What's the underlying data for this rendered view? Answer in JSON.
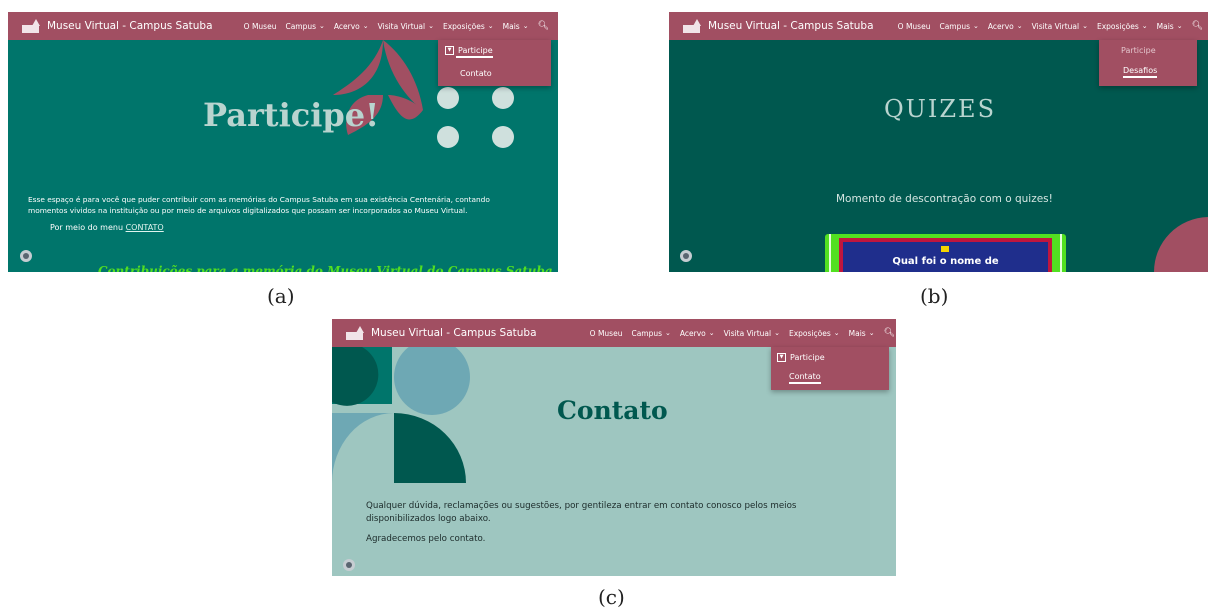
{
  "nav": {
    "site_title": "Museu Virtual - Campus Satuba",
    "items": [
      "O Museu",
      "Campus",
      "Acervo",
      "Visita Virtual",
      "Exposições",
      "Mais"
    ]
  },
  "panel_a": {
    "dropdown": [
      "Participe",
      "Contato"
    ],
    "heading": "Participe!",
    "paragraph": "Esse espaço é para você que puder contribuir com as memórias do Campus Satuba em sua existência Centenária, contando momentos vividos na instituição ou por meio de arquivos digitalizados que possam ser incorporados ao Museu Virtual.",
    "contact_prefix": "Por meio do menu",
    "contact_link": "CONTATO",
    "cut_heading": "Contribuições para a memória do Museu Virtual do Campus Satuba",
    "caption": "(a)"
  },
  "panel_b": {
    "dropdown": [
      "Participe",
      "Desafios"
    ],
    "heading": "QUIZES",
    "subtitle": "Momento de descontração com o quizes!",
    "quiz_text": "Qual foi o nome de",
    "caption": "(b)"
  },
  "panel_c": {
    "dropdown": [
      "Participe",
      "Contato"
    ],
    "heading": "Contato",
    "paragraph": "Qualquer dúvida, reclamações ou sugestões, por gentileza entrar em contato conosco pelos meios disponibilizados logo abaixo.",
    "thanks": "Agradecemos pelo contato.",
    "caption": "(c)"
  },
  "colors": {
    "nav": "#a14f62",
    "teal_a": "#00756b",
    "teal_b": "#00584f",
    "mint_c": "#9ec6c0",
    "yellow_green": "#52e021"
  },
  "icons": [
    "logo-icon",
    "chevron-down-icon",
    "search-icon",
    "dropdown-icon",
    "settings-icon"
  ]
}
